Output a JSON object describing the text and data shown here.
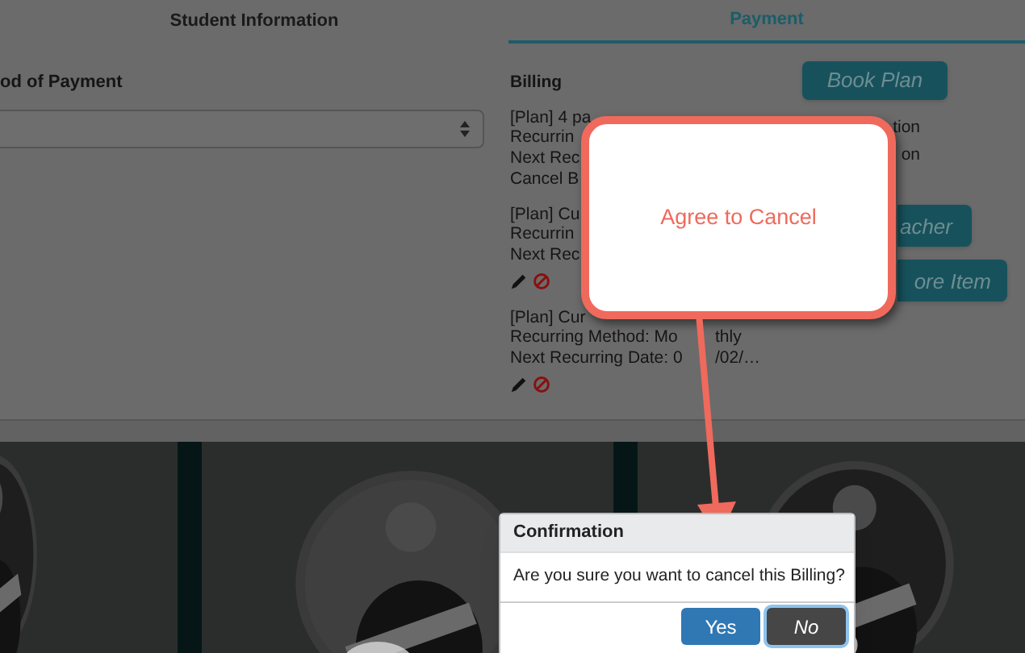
{
  "tabs": [
    {
      "label": "Student Information",
      "selected": false
    },
    {
      "label": "Payment",
      "selected": true
    }
  ],
  "payment_method": {
    "label": "od of Payment"
  },
  "billing": {
    "title": "Billing",
    "entries": [
      {
        "lines": [
          {
            "text": "[Plan] 4 pa"
          },
          {
            "text": "Recurrin",
            "tail": "tion"
          },
          {
            "text": "Next Rec",
            "tail": "on"
          },
          {
            "text": "Cancel B"
          }
        ],
        "actions": false
      },
      {
        "lines": [
          {
            "text": "[Plan] Cu"
          },
          {
            "text": "Recurrin"
          },
          {
            "text": "Next Rec"
          }
        ],
        "actions": true
      },
      {
        "lines": [
          {
            "text": "[Plan] Cur"
          },
          {
            "text": "Recurring Method: Mo",
            "after": "thly"
          },
          {
            "text": "Next Recurring Date: 0",
            "after": "/02/…"
          }
        ],
        "actions": true
      }
    ]
  },
  "buttons": [
    "Book Plan",
    "acher",
    "ore Item"
  ],
  "annotation": {
    "text": "Agree to Cancel"
  },
  "dialog": {
    "title": "Confirmation",
    "message": "Are you sure you want to cancel this Billing?",
    "buttons": [
      {
        "label": "Yes",
        "kind": "primary",
        "selected": false
      },
      {
        "label": "No",
        "kind": "default",
        "selected": true
      }
    ]
  }
}
